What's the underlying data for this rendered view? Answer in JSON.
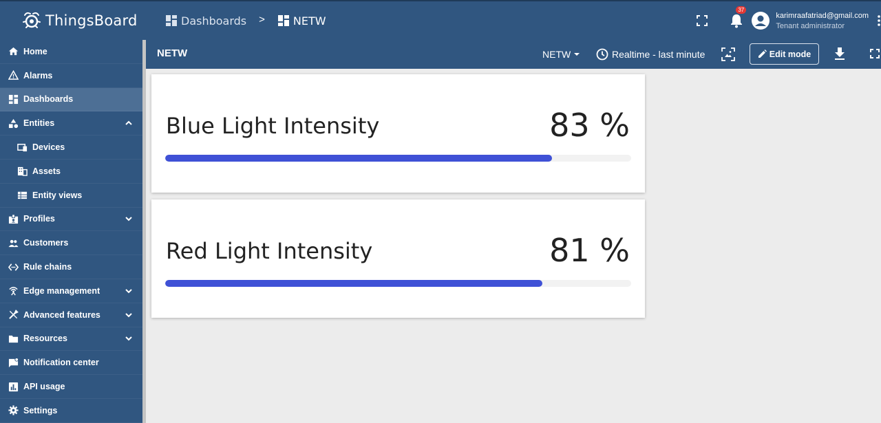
{
  "app": {
    "name": "ThingsBoard"
  },
  "breadcrumb": {
    "root": "Dashboards",
    "separator": ">",
    "current": "NETW"
  },
  "header": {
    "notifications_count": "37",
    "user_email": "karimraafatriad@gmail.com",
    "user_role": "Tenant administrator"
  },
  "sidebar": {
    "items": [
      {
        "label": "Home",
        "icon": "home-icon"
      },
      {
        "label": "Alarms",
        "icon": "warning-icon"
      },
      {
        "label": "Dashboards",
        "icon": "dashboard-icon",
        "active": true
      },
      {
        "label": "Entities",
        "icon": "shapes-icon",
        "expanded": true
      },
      {
        "label": "Devices",
        "icon": "devices-icon",
        "sub": true
      },
      {
        "label": "Assets",
        "icon": "building-icon",
        "sub": true
      },
      {
        "label": "Entity views",
        "icon": "view-list-icon",
        "sub": true
      },
      {
        "label": "Profiles",
        "icon": "badge-icon"
      },
      {
        "label": "Customers",
        "icon": "people-icon"
      },
      {
        "label": "Rule chains",
        "icon": "settings-ethernet-icon"
      },
      {
        "label": "Edge management",
        "icon": "router-icon"
      },
      {
        "label": "Advanced features",
        "icon": "tools-icon"
      },
      {
        "label": "Resources",
        "icon": "folder-icon"
      },
      {
        "label": "Notification center",
        "icon": "mark-chat-icon"
      },
      {
        "label": "API usage",
        "icon": "insert-chart-icon"
      },
      {
        "label": "Settings",
        "icon": "gear-icon"
      }
    ]
  },
  "dashboard": {
    "title": "NETW",
    "state": "NETW",
    "timewindow": "Realtime - last minute",
    "edit_label": "Edit mode"
  },
  "widgets": [
    {
      "label": "Blue Light Intensity",
      "value": "83 %",
      "progress": 0.83
    },
    {
      "label": "Red Light Intensity",
      "value": "81 %",
      "progress": 0.81
    }
  ],
  "colors": {
    "primary": "#305680",
    "progress": "#3f51d6",
    "badge": "#e53935"
  }
}
